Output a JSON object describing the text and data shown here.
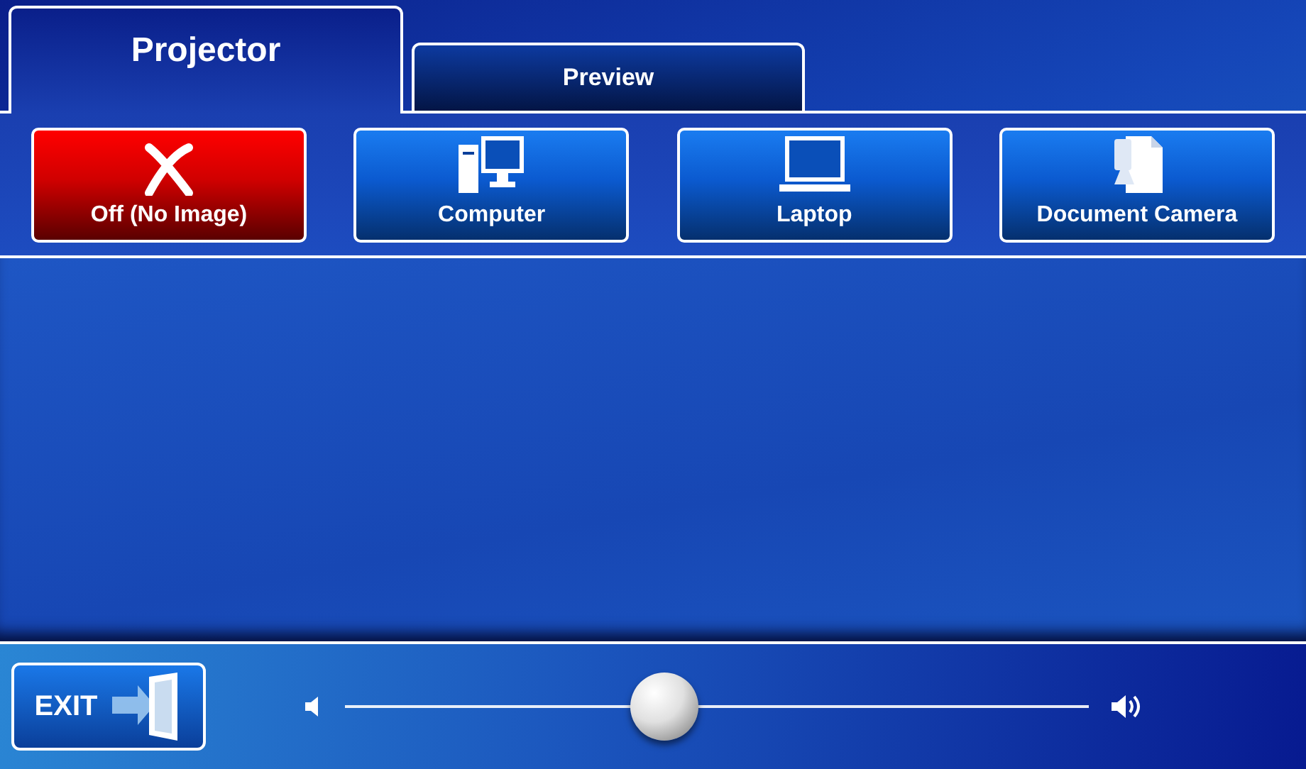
{
  "tabs": [
    {
      "label": "Projector",
      "selected": true
    },
    {
      "label": "Preview",
      "selected": false
    }
  ],
  "sources": [
    {
      "label": "Off (No Image)",
      "kind": "off",
      "selected": true
    },
    {
      "label": "Computer",
      "kind": "computer",
      "selected": false
    },
    {
      "label": "Laptop",
      "kind": "laptop",
      "selected": false
    },
    {
      "label": "Document Camera",
      "kind": "document-camera",
      "selected": false
    }
  ],
  "exit_button": {
    "label": "EXIT"
  },
  "volume": {
    "level": 0.43
  }
}
